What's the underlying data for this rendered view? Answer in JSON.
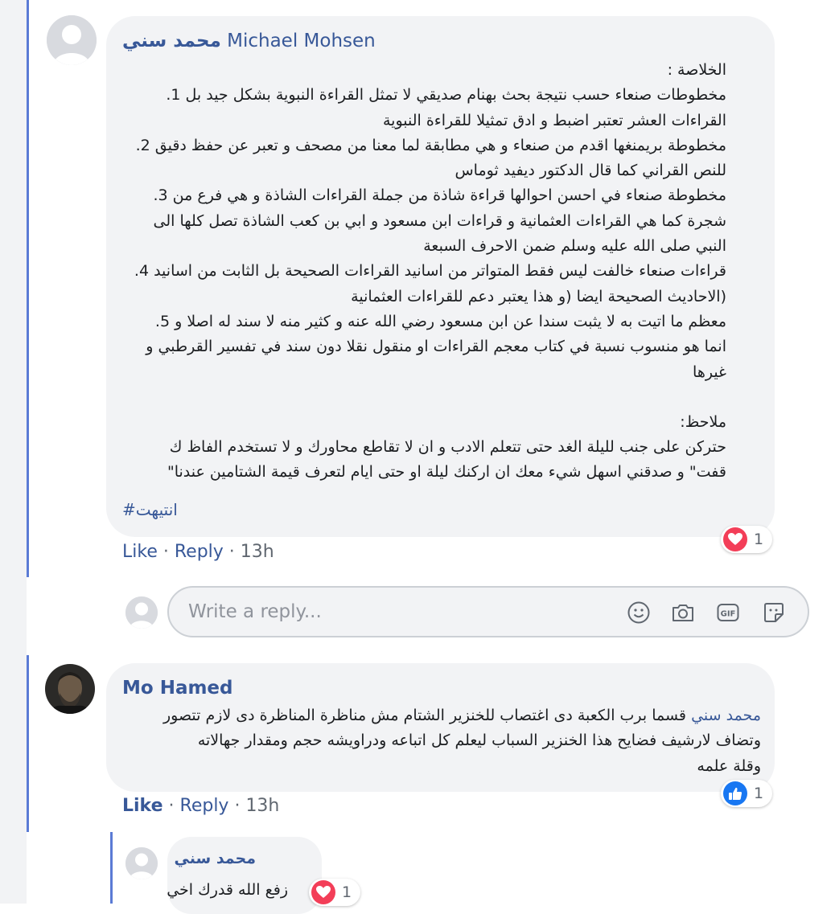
{
  "comment1": {
    "author_ar": "محمد سني",
    "author_en": "Michael Mohsen",
    "lines": [
      "الخلاصة :",
      "مخطوطات صنعاء حسب نتيجة بحث بهنام صديقي لا تمثل القراءة النبوية بشكل جيد بل 1.",
      "القراءات العشر تعتبر اضبط و ادق تمثيلا للقراءة النبوية",
      "مخطوطة بريمنغها اقدم من صنعاء و هي مطابقة لما معنا من مصحف و تعبر عن حفظ دقيق 2.",
      "للنص القراني كما قال الدكتور ديفيد ثوماس",
      "مخطوطة صنعاء في احسن احوالها قراءة شاذة من جملة القراءات الشاذة و هي فرع من 3.",
      "شجرة كما هي القراءات العثمانية و قراءات ابن مسعود و ابي بن كعب الشاذة تصل كلها الى",
      "النبي صلى الله عليه وسلم ضمن الاحرف السبعة",
      "قراءات صنعاء خالفت ليس فقط المتواتر من اسانيد القراءات الصحيحة بل الثابت من اسانيد 4.",
      "(الاحاديث الصحيحة ايضا (و هذا يعتبر دعم للقراءات العثمانية",
      "معظم ما اتيت به لا يثبت سندا عن ابن مسعود رضي الله عنه و كثير منه لا سند له اصلا و 5.",
      "انما هو منسوب نسبة في كتاب معجم القراءات او منقول نقلا دون سند في تفسير القرطبي و",
      "غيرها",
      "",
      "ملاحظ:",
      "حتركن على جنب لليلة الغد حتى تتعلم الادب و ان لا تقاطع محاورك و لا تستخدم الفاظ ك",
      "قفت\" و صدقني اسهل شيء معك ان اركنك ليلة او حتى ايام لتعرف قيمة الشتامين عندنا\""
    ],
    "hashtag": "#انتيهت",
    "like": "Like",
    "reply": "Reply",
    "sep": " · ",
    "time": "13h",
    "reaction": {
      "type": "love",
      "count": "1"
    }
  },
  "reply_box": {
    "placeholder": "Write a reply...",
    "icons": [
      "emoji-icon",
      "camera-icon",
      "gif-icon",
      "sticker-icon"
    ],
    "gif_label": "GIF"
  },
  "comment2": {
    "author": "Mo Hamed",
    "mention": "محمد سني",
    "line1_rest": "قسما برب الكعبة دى اغتصاب للخنزير الشتام مش مناظرة المناظرة دى لازم تتصور",
    "lines": [
      "وتضاف لارشيف فضايح هذا الخنزير السباب ليعلم كل اتباعه ودراويشه حجم ومقدار جهالاته",
      "وقلة علمه"
    ],
    "like": "Like",
    "reply": "Reply",
    "sep": " · ",
    "time": "13h",
    "reaction": {
      "type": "like",
      "count": "1"
    }
  },
  "comment3": {
    "author": "محمد سني",
    "text": "زفع الله قدرك اخي",
    "reaction": {
      "type": "love",
      "count": "1"
    }
  },
  "colors": {
    "link": "#385898",
    "bubble": "#f2f3f5",
    "thread_line": "#5b7bd5",
    "love": "#f33e58",
    "like": "#1877f2"
  }
}
